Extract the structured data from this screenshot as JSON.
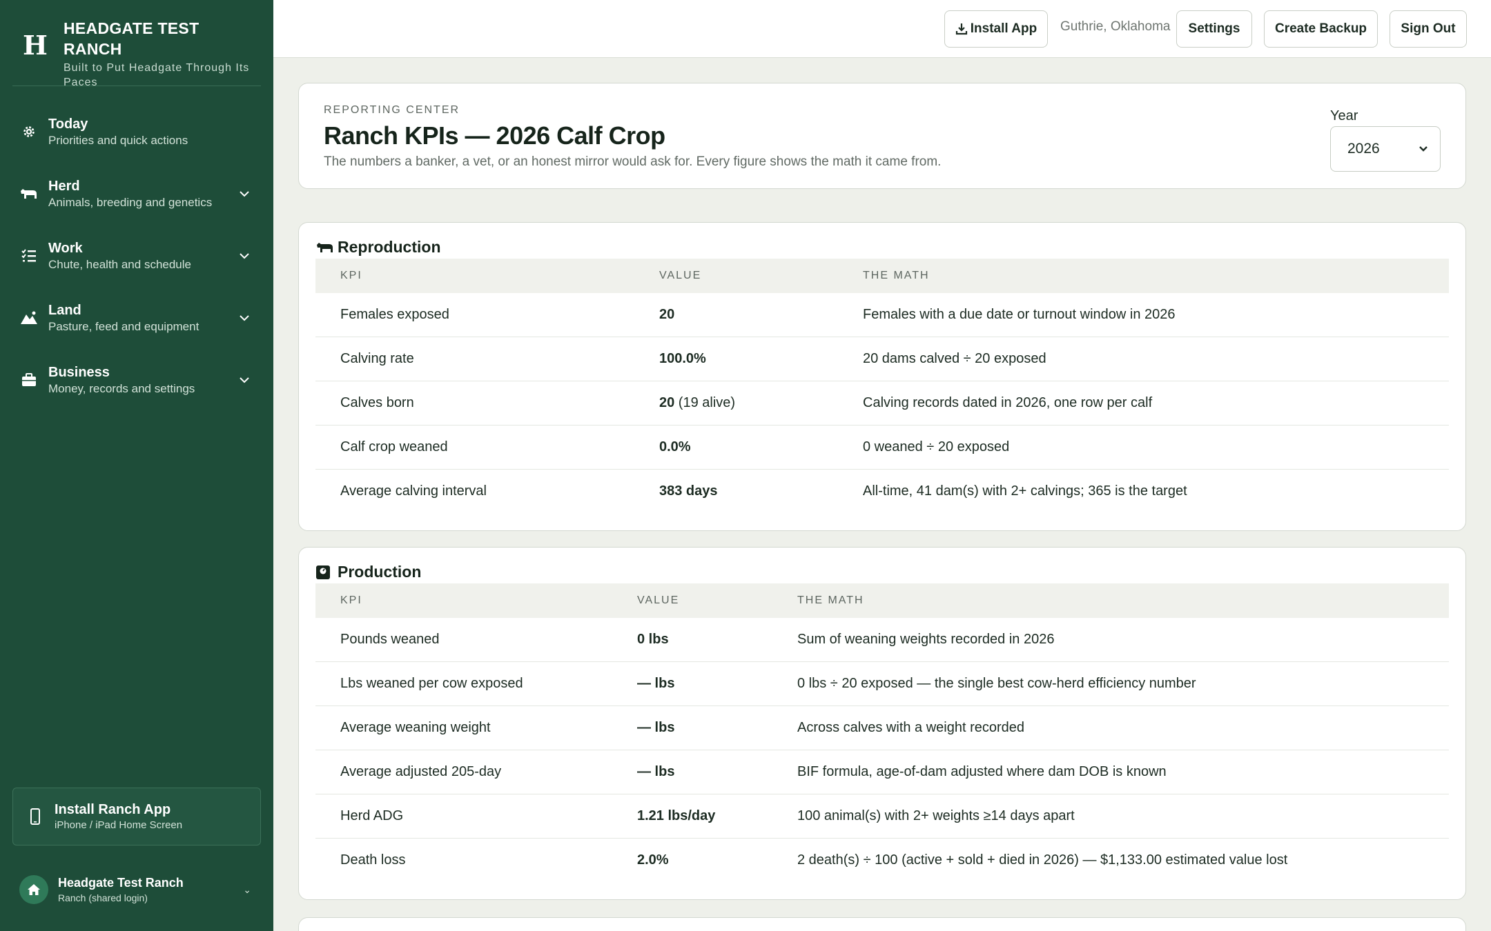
{
  "brand": {
    "title": "HEADGATE TEST RANCH",
    "subtitle": "Built to Put Headgate Through Its Paces"
  },
  "nav": [
    {
      "label": "Today",
      "sub": "Priorities and quick actions",
      "icon": "gear-icon",
      "expandable": false
    },
    {
      "label": "Herd",
      "sub": "Animals, breeding and genetics",
      "icon": "cow-icon",
      "expandable": true
    },
    {
      "label": "Work",
      "sub": "Chute, health and schedule",
      "icon": "checklist-icon",
      "expandable": true
    },
    {
      "label": "Land",
      "sub": "Pasture, feed and equipment",
      "icon": "mountain-icon",
      "expandable": true
    },
    {
      "label": "Business",
      "sub": "Money, records and settings",
      "icon": "briefcase-icon",
      "expandable": true
    }
  ],
  "install_card": {
    "title": "Install Ranch App",
    "sub": "iPhone / iPad Home Screen"
  },
  "account": {
    "name": "Headgate Test Ranch",
    "sub": "Ranch (shared login)",
    "caret": "⌄"
  },
  "topbar": {
    "install_label": "Install App",
    "location": "Guthrie, Oklahoma",
    "settings_label": "Settings",
    "backup_label": "Create Backup",
    "signout_label": "Sign Out"
  },
  "header": {
    "eyebrow": "REPORTING CENTER",
    "title": "Ranch KPIs — 2026 Calf Crop",
    "subtitle": "The numbers a banker, a vet, or an honest mirror would ask for. Every figure shows the math it came from.",
    "year_label": "Year",
    "year_value": "2026"
  },
  "reproduction": {
    "title": "Reproduction",
    "columns": {
      "kpi": "KPI",
      "value": "VALUE",
      "math": "THE MATH"
    },
    "rows": [
      {
        "kpi": "Females exposed",
        "value": "20",
        "extra": "",
        "math": "Females with a due date or turnout window in 2026"
      },
      {
        "kpi": "Calving rate",
        "value": "100.0%",
        "extra": "",
        "math": "20 dams calved ÷ 20 exposed"
      },
      {
        "kpi": "Calves born",
        "value": "20",
        "extra": " (19 alive)",
        "math": "Calving records dated in 2026, one row per calf"
      },
      {
        "kpi": "Calf crop weaned",
        "value": "0.0%",
        "extra": "",
        "math": "0 weaned ÷ 20 exposed"
      },
      {
        "kpi": "Average calving interval",
        "value": "383 days",
        "extra": "",
        "math": "All-time, 41 dam(s) with 2+ calvings; 365 is the target"
      }
    ]
  },
  "production": {
    "title": "Production",
    "columns": {
      "kpi": "KPI",
      "value": "VALUE",
      "math": "THE MATH"
    },
    "rows": [
      {
        "kpi": "Pounds weaned",
        "value": "0 lbs",
        "math": "Sum of weaning weights recorded in 2026"
      },
      {
        "kpi": "Lbs weaned per cow exposed",
        "value": "— lbs",
        "math": "0 lbs ÷ 20 exposed — the single best cow-herd efficiency number"
      },
      {
        "kpi": "Average weaning weight",
        "value": "— lbs",
        "math": "Across calves with a weight recorded"
      },
      {
        "kpi": "Average adjusted 205-day",
        "value": "— lbs",
        "math": "BIF formula, age-of-dam adjusted where dam DOB is known"
      },
      {
        "kpi": "Herd ADG",
        "value": "1.21 lbs/day",
        "math": "100 animal(s) with 2+ weights ≥14 days apart"
      },
      {
        "kpi": "Death loss",
        "value": "2.0%",
        "math": "2 death(s) ÷ 100 (active + sold + died in 2026) — $1,133.00 estimated value lost"
      }
    ]
  },
  "colors": {
    "sidebar": "#1e4d39",
    "background": "#eef0ea",
    "card": "#ffffff"
  }
}
